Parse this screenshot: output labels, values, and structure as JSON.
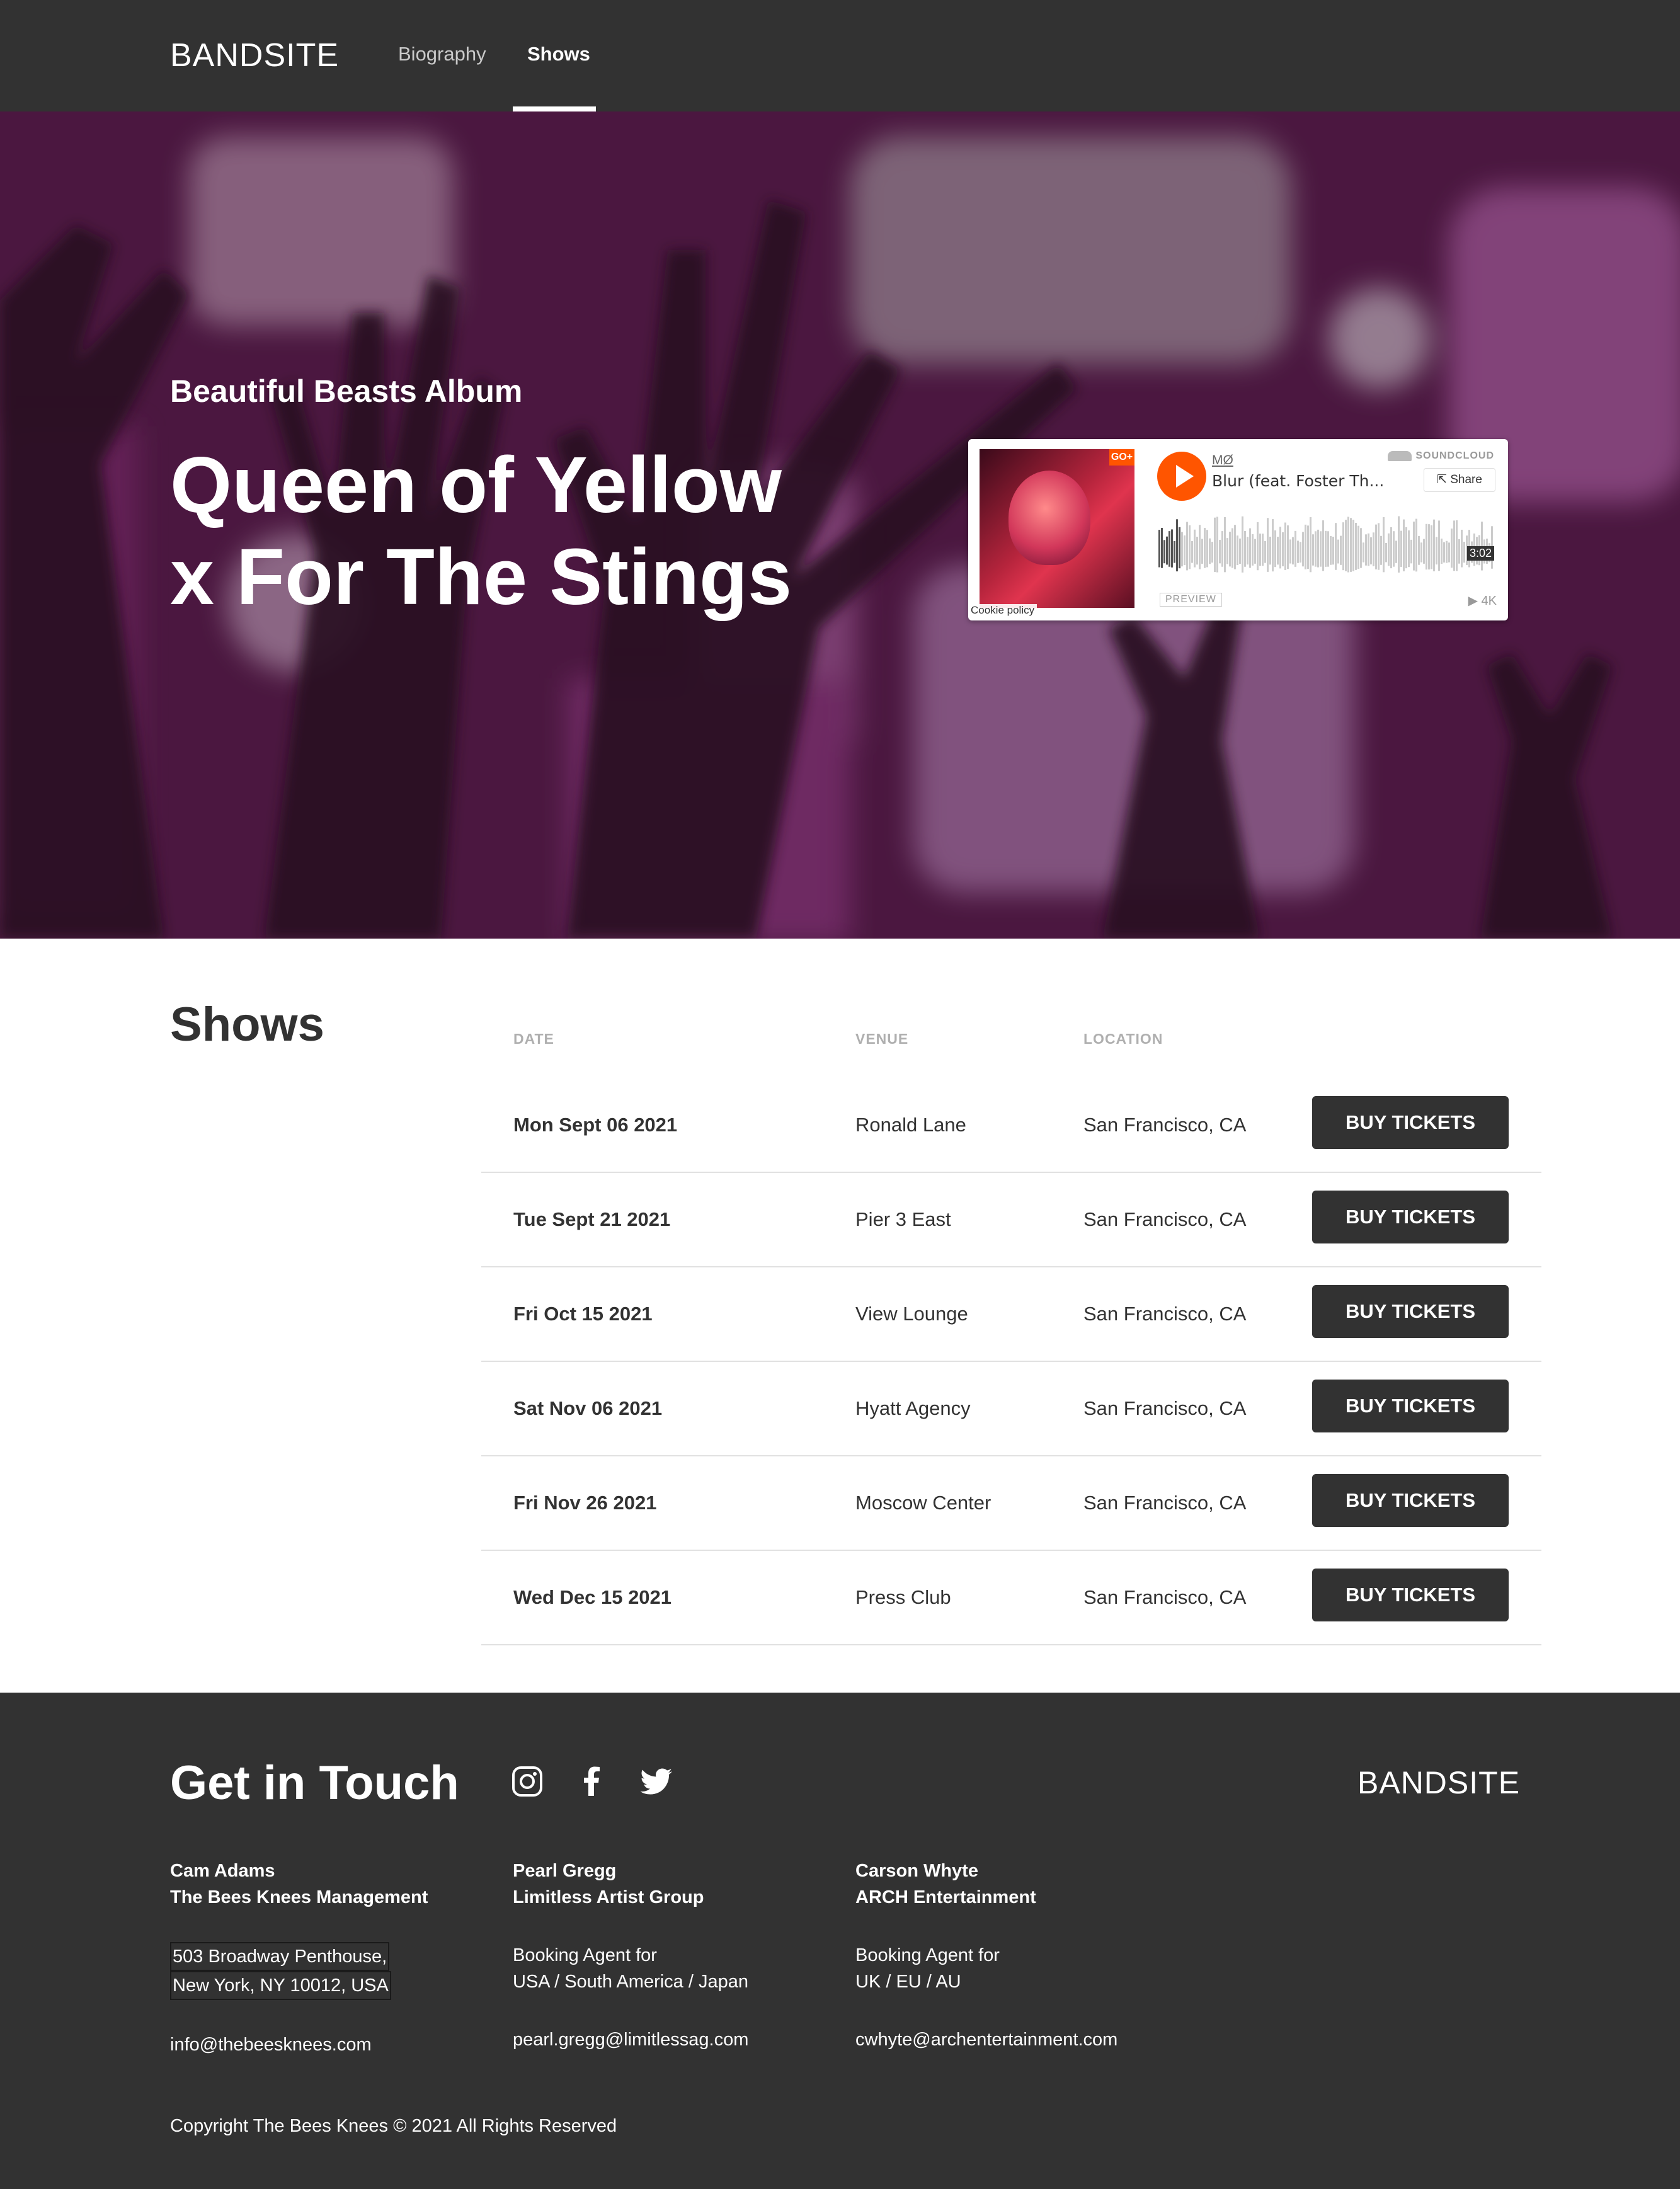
{
  "nav": {
    "logo": "BANDSITE",
    "links": [
      "Biography",
      "Shows"
    ]
  },
  "hero": {
    "subtitle": "Beautiful Beasts Album",
    "title_line1": "Queen of Yellow",
    "title_line2": "x For The Stings"
  },
  "soundcloud": {
    "artist": "MØ",
    "track": "Blur (feat. Foster Th...",
    "brand": "SOUNDCLOUD",
    "share_label": "Share",
    "duration": "3:02",
    "preview_label": "PREVIEW",
    "plays": "▶ 4K",
    "cookie_label": "Cookie policy",
    "badge": "GO+",
    "accent_color": "#ff5500",
    "playback_progress": 0.07
  },
  "shows": {
    "title": "Shows",
    "headers": {
      "date": "DATE",
      "venue": "VENUE",
      "location": "LOCATION"
    },
    "button_label": "BUY TICKETS",
    "rows": [
      {
        "date": "Mon Sept 06 2021",
        "venue": "Ronald Lane",
        "location": "San Francisco, CA"
      },
      {
        "date": "Tue Sept 21 2021",
        "venue": "Pier 3 East",
        "location": "San Francisco, CA"
      },
      {
        "date": "Fri Oct 15 2021",
        "venue": "View Lounge",
        "location": "San Francisco, CA"
      },
      {
        "date": "Sat Nov 06 2021",
        "venue": "Hyatt Agency",
        "location": "San Francisco, CA"
      },
      {
        "date": "Fri Nov 26 2021",
        "venue": "Moscow Center",
        "location": "San Francisco, CA"
      },
      {
        "date": "Wed Dec 15 2021",
        "venue": "Press Club",
        "location": "San Francisco, CA"
      }
    ]
  },
  "footer": {
    "title": "Get in Touch",
    "logo": "BANDSITE",
    "social_icons": [
      "instagram-icon",
      "facebook-icon",
      "twitter-icon"
    ],
    "contacts": [
      {
        "name": "Cam Adams",
        "company": "The Bees Knees Management",
        "line1": "503 Broadway Penthouse,",
        "line2": "New York, NY 10012, USA",
        "email": "info@thebeesknees.com"
      },
      {
        "name": "Pearl Gregg",
        "company": "Limitless Artist Group",
        "line1": "Booking Agent for",
        "line2": "USA / South America / Japan",
        "email": "pearl.gregg@limitlessag.com"
      },
      {
        "name": "Carson Whyte",
        "company": "ARCH Entertainment",
        "line1": "Booking Agent for",
        "line2": "UK / EU / AU",
        "email": "cwhyte@archentertainment.com"
      }
    ],
    "copyright": "Copyright The Bees Knees © 2021 All Rights Reserved"
  },
  "colors": {
    "dark": "#323232",
    "muted": "#afafaf",
    "divider": "#e1e1e1"
  }
}
